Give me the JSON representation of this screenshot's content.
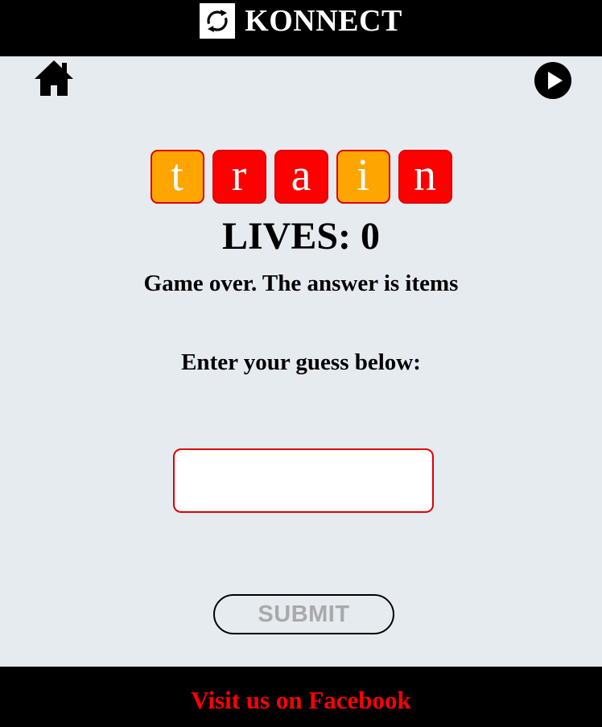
{
  "header": {
    "title": "KONNECT",
    "logo_icon": "refresh-arrows-icon"
  },
  "nav": {
    "home_icon": "home-icon",
    "play_icon": "play-icon"
  },
  "tiles": [
    {
      "letter": "t",
      "color": "#ffa500"
    },
    {
      "letter": "r",
      "color": "#ff0000"
    },
    {
      "letter": "a",
      "color": "#ff0000"
    },
    {
      "letter": "i",
      "color": "#ffa500"
    },
    {
      "letter": "n",
      "color": "#ff0000"
    }
  ],
  "status": {
    "lives_label": "LIVES:",
    "lives_value": "0",
    "message": "Game over. The answer is items",
    "prompt": "Enter your guess below:"
  },
  "guess": {
    "value": "",
    "placeholder": ""
  },
  "submit": {
    "label": "SUBMIT"
  },
  "footer": {
    "link_text": "Visit us on Facebook"
  },
  "colors": {
    "background": "#e6ebf0",
    "header": "#000000",
    "accent_red": "#ff0000",
    "accent_orange": "#ffa500",
    "submit_text": "#a9a9a9"
  }
}
